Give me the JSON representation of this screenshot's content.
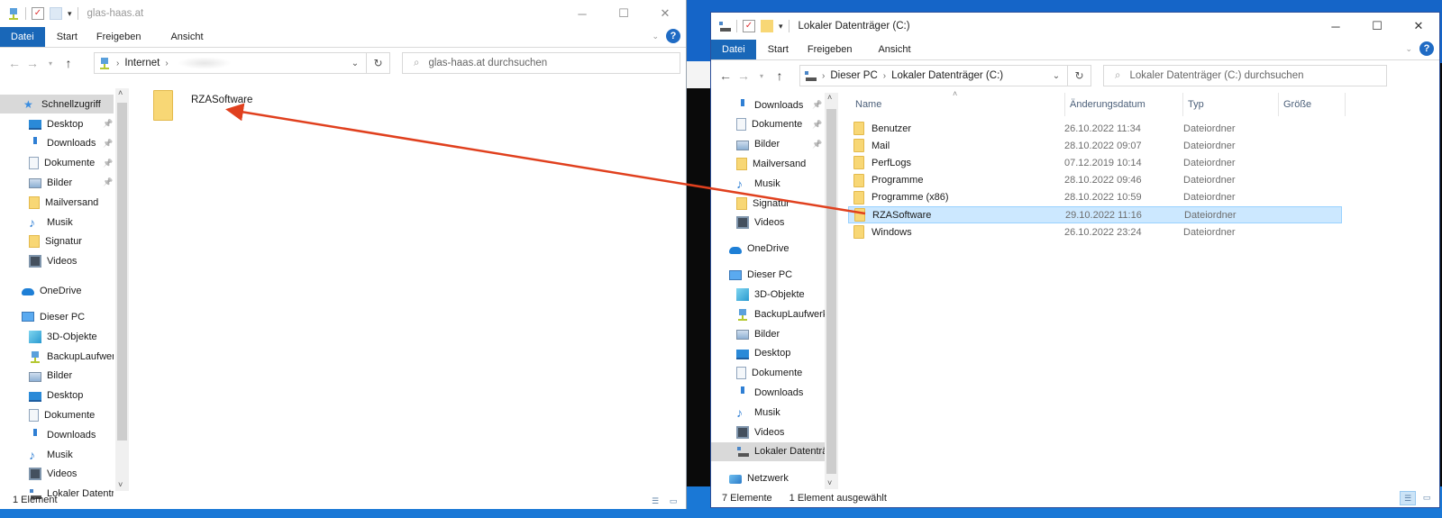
{
  "left_window": {
    "title": "glas-haas.at",
    "ribbon_tabs": [
      "Datei",
      "Start",
      "Freigeben",
      "Ansicht"
    ],
    "address": {
      "root": "Internet",
      "path_hidden": true
    },
    "search_placeholder": "glas-haas.at durchsuchen",
    "nav": {
      "quick_access_label": "Schnellzugriff",
      "quick_access": [
        {
          "label": "Desktop",
          "icon": "desktop-icon",
          "pinned": true
        },
        {
          "label": "Downloads",
          "icon": "downloads-icon",
          "pinned": true
        },
        {
          "label": "Dokumente",
          "icon": "documents-icon",
          "pinned": true
        },
        {
          "label": "Bilder",
          "icon": "pictures-icon",
          "pinned": true
        },
        {
          "label": "Mailversand",
          "icon": "folder-icon",
          "pinned": false
        },
        {
          "label": "Musik",
          "icon": "music-icon",
          "pinned": false
        },
        {
          "label": "Signatur",
          "icon": "folder-icon",
          "pinned": false
        },
        {
          "label": "Videos",
          "icon": "videos-icon",
          "pinned": false
        }
      ],
      "onedrive": "OneDrive",
      "this_pc": "Dieser PC",
      "this_pc_items": [
        {
          "label": "3D-Objekte",
          "icon": "3d-objects-icon"
        },
        {
          "label": "BackupLaufwerk",
          "icon": "network-drive-icon"
        },
        {
          "label": "Bilder",
          "icon": "pictures-icon"
        },
        {
          "label": "Desktop",
          "icon": "desktop-icon"
        },
        {
          "label": "Dokumente",
          "icon": "documents-icon"
        },
        {
          "label": "Downloads",
          "icon": "downloads-icon"
        },
        {
          "label": "Musik",
          "icon": "music-icon"
        },
        {
          "label": "Videos",
          "icon": "videos-icon"
        },
        {
          "label": "Lokaler Datenträ",
          "icon": "local-disk-icon"
        }
      ]
    },
    "content_items": [
      {
        "name": "RZASoftware",
        "type": "folder"
      }
    ],
    "status": "1 Element"
  },
  "right_window": {
    "title": "Lokaler Datenträger (C:)",
    "ribbon_tabs": [
      "Datei",
      "Start",
      "Freigeben",
      "Ansicht"
    ],
    "address": {
      "crumbs": [
        "Dieser PC",
        "Lokaler Datenträger (C:)"
      ]
    },
    "search_placeholder": "Lokaler Datenträger (C:) durchsuchen",
    "nav": {
      "quick_access": [
        {
          "label": "Downloads",
          "icon": "downloads-icon",
          "pinned": true
        },
        {
          "label": "Dokumente",
          "icon": "documents-icon",
          "pinned": true
        },
        {
          "label": "Bilder",
          "icon": "pictures-icon",
          "pinned": true
        },
        {
          "label": "Mailversand",
          "icon": "folder-icon",
          "pinned": false
        },
        {
          "label": "Musik",
          "icon": "music-icon",
          "pinned": false
        },
        {
          "label": "Signatur",
          "icon": "folder-icon",
          "pinned": false
        },
        {
          "label": "Videos",
          "icon": "videos-icon",
          "pinned": false
        }
      ],
      "onedrive": "OneDrive",
      "this_pc": "Dieser PC",
      "this_pc_items": [
        {
          "label": "3D-Objekte",
          "icon": "3d-objects-icon"
        },
        {
          "label": "BackupLaufwerk",
          "icon": "network-drive-icon"
        },
        {
          "label": "Bilder",
          "icon": "pictures-icon"
        },
        {
          "label": "Desktop",
          "icon": "desktop-icon"
        },
        {
          "label": "Dokumente",
          "icon": "documents-icon"
        },
        {
          "label": "Downloads",
          "icon": "downloads-icon"
        },
        {
          "label": "Musik",
          "icon": "music-icon"
        },
        {
          "label": "Videos",
          "icon": "videos-icon"
        },
        {
          "label": "Lokaler Datenträ",
          "icon": "local-disk-icon",
          "selected": true
        }
      ],
      "network": "Netzwerk"
    },
    "columns": [
      "Name",
      "Änderungsdatum",
      "Typ",
      "Größe"
    ],
    "rows": [
      {
        "name": "Benutzer",
        "date": "26.10.2022 11:34",
        "type": "Dateiordner",
        "size": ""
      },
      {
        "name": "Mail",
        "date": "28.10.2022 09:07",
        "type": "Dateiordner",
        "size": ""
      },
      {
        "name": "PerfLogs",
        "date": "07.12.2019 10:14",
        "type": "Dateiordner",
        "size": ""
      },
      {
        "name": "Programme",
        "date": "28.10.2022 09:46",
        "type": "Dateiordner",
        "size": ""
      },
      {
        "name": "Programme (x86)",
        "date": "28.10.2022 10:59",
        "type": "Dateiordner",
        "size": ""
      },
      {
        "name": "RZASoftware",
        "date": "29.10.2022 11:16",
        "type": "Dateiordner",
        "size": "",
        "selected": true
      },
      {
        "name": "Windows",
        "date": "26.10.2022 23:24",
        "type": "Dateiordner",
        "size": ""
      }
    ],
    "status": {
      "count": "7 Elemente",
      "selection": "1 Element ausgewählt"
    }
  },
  "annotation": {
    "type": "arrow",
    "color": "#e0401e",
    "from": "right_window.rows.RZASoftware",
    "to": "left_window.content_items.RZASoftware"
  }
}
